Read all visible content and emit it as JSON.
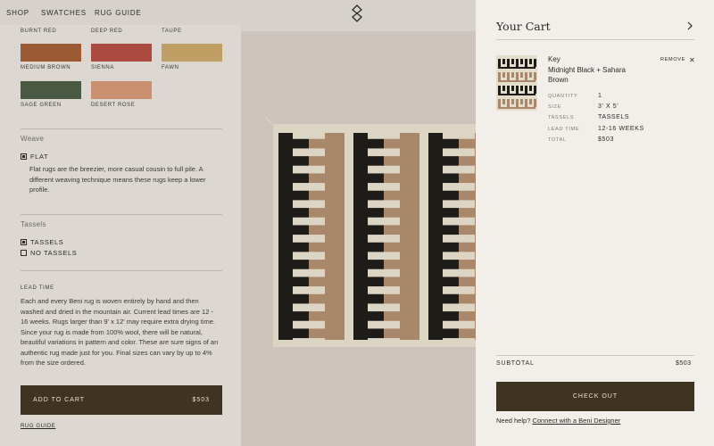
{
  "nav": {
    "items": [
      "SHOP",
      "SWATCHES",
      "RUG GUIDE"
    ]
  },
  "swatches": [
    {
      "name": "BURNT RED",
      "color": "#9b4a2c"
    },
    {
      "name": "DEEP RED",
      "color": "#a84a40"
    },
    {
      "name": "TAUPE",
      "color": "#c0a35e"
    },
    {
      "name": "MEDIUM BROWN",
      "color": "#5e4f3c"
    },
    {
      "name": "SIENNA",
      "color": "#b65c3c"
    },
    {
      "name": "FAWN",
      "color": "#c49c7e"
    },
    {
      "name": "SAGE GREEN",
      "color": "#7e4a30"
    },
    {
      "name": "DESERT ROSE",
      "color": "#d0a37f"
    }
  ],
  "weave": {
    "label": "Weave",
    "option": "FLAT",
    "description": "Flat rugs are the breezier, more casual cousin to full pile. A different weaving technique means these rugs keep a lower profile."
  },
  "tassels": {
    "label": "Tassels",
    "options": [
      "TASSELS",
      "NO TASSELS"
    ]
  },
  "lead_time": {
    "label": "LEAD TIME",
    "text": "Each and every Beni rug is woven entirely by hand and then washed and dried in the mountain air. Current lead times are 12 - 16 weeks. Rugs larger than 9' x 12' may require extra drying time. Since your rug is made from 100% wool, there will be natural, beautiful variations in pattern and color. These are sure signs of an authentic rug made just for you. Final sizes can vary by up to 4% from the size ordered."
  },
  "add_to_cart": {
    "label": "ADD TO CART",
    "price": "$503"
  },
  "rug_guide_link": "RUG GUIDE",
  "cart": {
    "title": "Your Cart",
    "item": {
      "name_line1": "Key",
      "name_line2": "Midnight Black + Sahara Brown",
      "remove": "REMOVE",
      "specs": [
        {
          "label": "QUANTITY",
          "value": "1"
        },
        {
          "label": "SIZE",
          "value": "3' X 5'"
        },
        {
          "label": "TASSELS",
          "value": "TASSELS"
        },
        {
          "label": "LEAD TIME",
          "value": "12-16 WEEKS"
        },
        {
          "label": "TOTAL",
          "value": "$503"
        }
      ]
    },
    "subtotal_label": "SUBTOTAL",
    "subtotal_value": "$503",
    "checkout": "CHECK OUT",
    "help_text": "Need help?",
    "help_link": "Connect with a Beni Designer"
  },
  "colors": {
    "accent": "#3f3321",
    "rug_black": "#1e1c19",
    "rug_brown": "#a9876a",
    "rug_base": "#ddd5c3"
  }
}
